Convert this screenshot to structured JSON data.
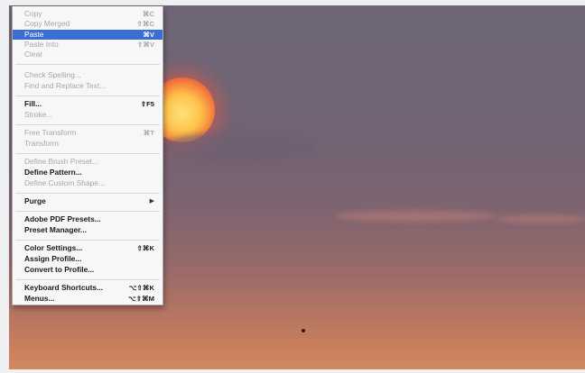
{
  "menu": {
    "items": [
      {
        "label": "Copy",
        "shortcut": "⌘C"
      },
      {
        "label": "Copy Merged",
        "shortcut": "⇧⌘C"
      },
      {
        "label": "Paste",
        "shortcut": "⌘V"
      },
      {
        "label": "Paste Into",
        "shortcut": "⇧⌘V"
      },
      {
        "label": "Clear",
        "shortcut": ""
      },
      {
        "label": "Check Spelling...",
        "shortcut": ""
      },
      {
        "label": "Find and Replace Text...",
        "shortcut": ""
      },
      {
        "label": "Fill...",
        "shortcut": "⇧F5"
      },
      {
        "label": "Stroke...",
        "shortcut": ""
      },
      {
        "label": "Free Transform",
        "shortcut": "⌘T"
      },
      {
        "label": "Transform",
        "shortcut": ""
      },
      {
        "label": "Define Brush Preset...",
        "shortcut": ""
      },
      {
        "label": "Define Pattern...",
        "shortcut": ""
      },
      {
        "label": "Define Custom Shape...",
        "shortcut": ""
      },
      {
        "label": "Purge",
        "shortcut": "▶"
      },
      {
        "label": "Adobe PDF Presets...",
        "shortcut": ""
      },
      {
        "label": "Preset Manager...",
        "shortcut": ""
      },
      {
        "label": "Color Settings...",
        "shortcut": "⇧⌘K"
      },
      {
        "label": "Assign Profile...",
        "shortcut": ""
      },
      {
        "label": "Convert to Profile...",
        "shortcut": ""
      },
      {
        "label": "Keyboard Shortcuts...",
        "shortcut": "⌥⇧⌘K"
      },
      {
        "label": "Menus...",
        "shortcut": "⌥⇧⌘M"
      }
    ]
  },
  "colors": {
    "highlight": "#3a6ed0",
    "disabled_text": "#a7a7ac",
    "menu_bg": "#f7f7f8"
  }
}
